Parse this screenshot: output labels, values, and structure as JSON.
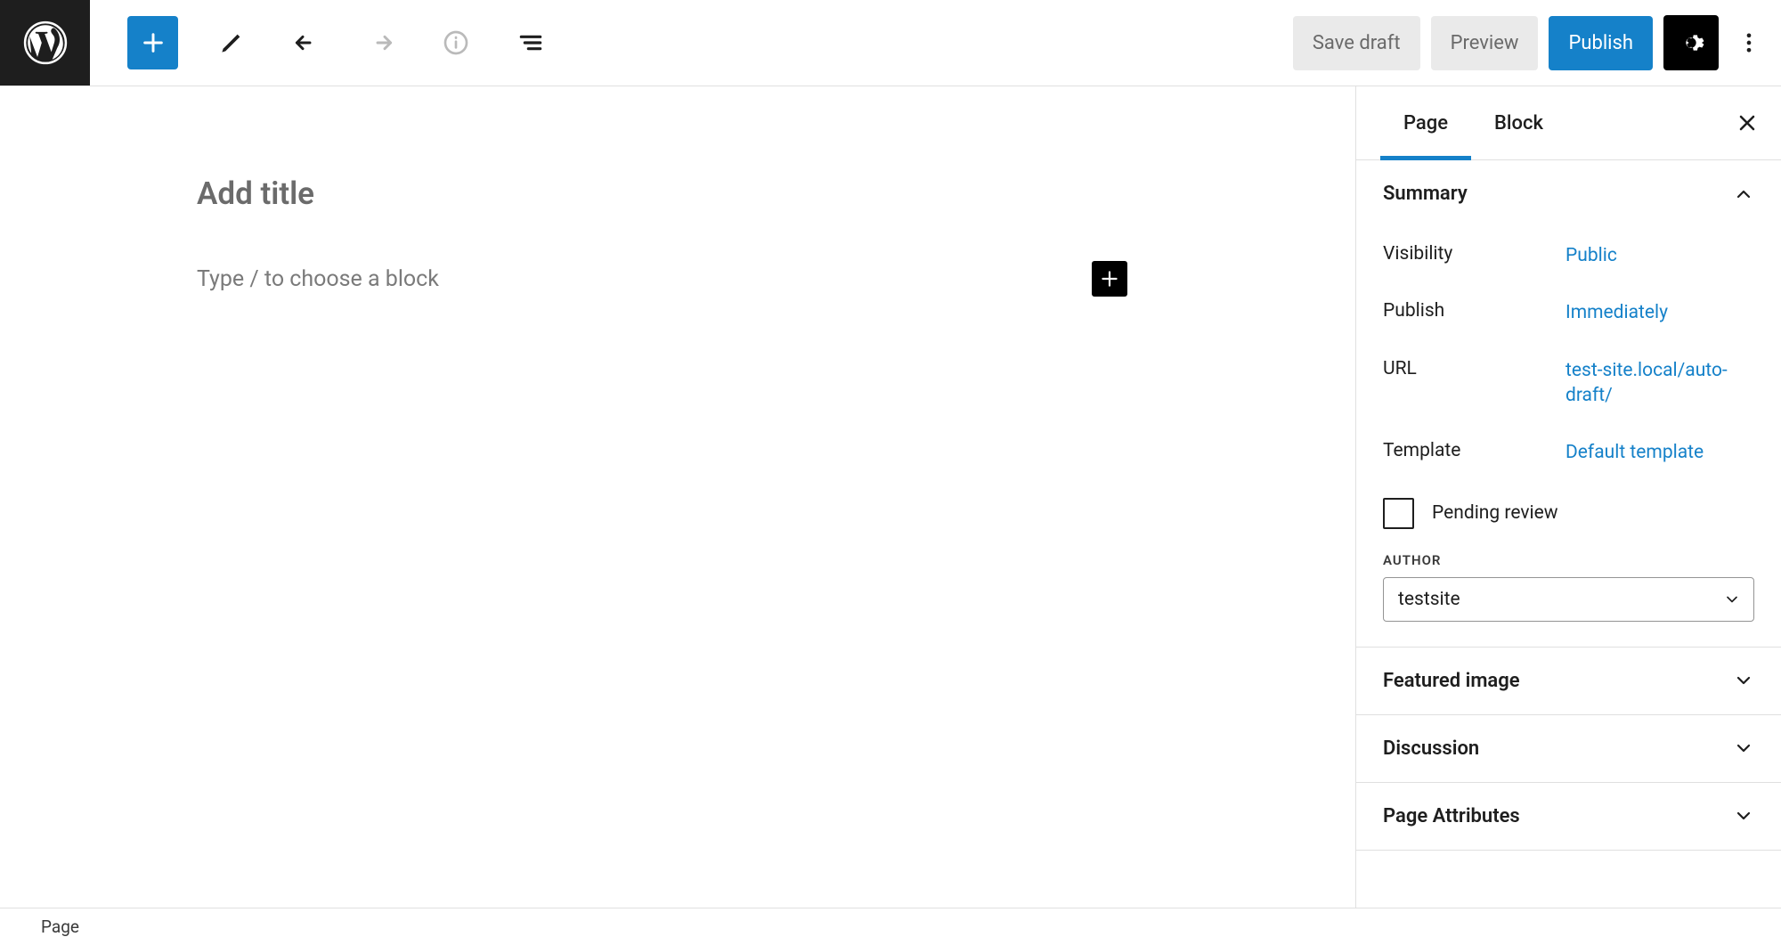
{
  "toolbar": {
    "save_draft": "Save draft",
    "preview": "Preview",
    "publish": "Publish"
  },
  "editor": {
    "title_placeholder": "Add title",
    "block_placeholder": "Type / to choose a block"
  },
  "sidebar": {
    "tabs": {
      "page": "Page",
      "block": "Block"
    },
    "summary": {
      "title": "Summary",
      "visibility_label": "Visibility",
      "visibility_value": "Public",
      "publish_label": "Publish",
      "publish_value": "Immediately",
      "url_label": "URL",
      "url_value": "test-site.local/auto-draft/",
      "template_label": "Template",
      "template_value": "Default template",
      "pending_review": "Pending review",
      "author_label": "AUTHOR",
      "author_value": "testsite"
    },
    "panels": {
      "featured_image": "Featured image",
      "discussion": "Discussion",
      "page_attributes": "Page Attributes"
    }
  },
  "footer": {
    "type": "Page"
  }
}
